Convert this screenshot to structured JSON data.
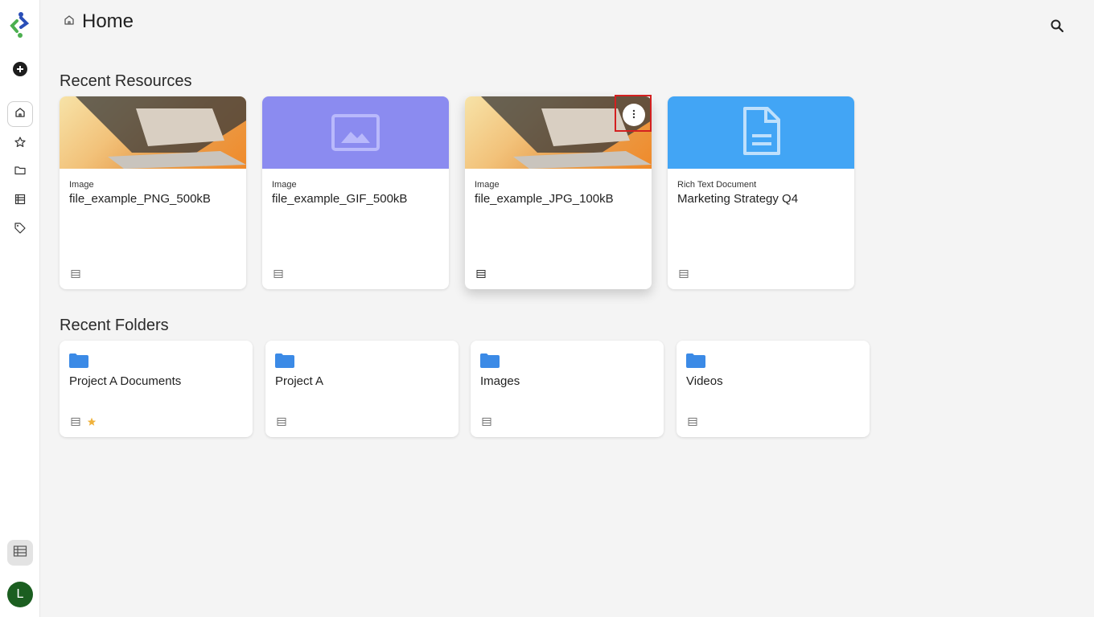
{
  "header": {
    "title": "Home"
  },
  "sidebar": {
    "items": [
      "home-icon",
      "star-icon",
      "folder-icon",
      "list-icon",
      "tag-icon"
    ],
    "avatar_initial": "L"
  },
  "sections": {
    "resources_title": "Recent Resources",
    "folders_title": "Recent Folders"
  },
  "resources": [
    {
      "type": "Image",
      "name": "file_example_PNG_500kB",
      "thumb": "photo"
    },
    {
      "type": "Image",
      "name": "file_example_GIF_500kB",
      "thumb": "placeholder-image",
      "color": "#8b8bf0"
    },
    {
      "type": "Image",
      "name": "file_example_JPG_100kB",
      "thumb": "photo"
    },
    {
      "type": "Rich Text Document",
      "name": "Marketing Strategy Q4",
      "thumb": "document",
      "color": "#42a5f5"
    }
  ],
  "folders": [
    {
      "name": "Project A Documents",
      "starred": true
    },
    {
      "name": "Project A",
      "starred": false
    },
    {
      "name": "Images",
      "starred": false
    },
    {
      "name": "Videos",
      "starred": false
    }
  ],
  "colors": {
    "accent_red": "#d32020",
    "folder_blue": "#3b8ae6",
    "avatar_green": "#1b5e20",
    "star": "#f0b23c"
  }
}
